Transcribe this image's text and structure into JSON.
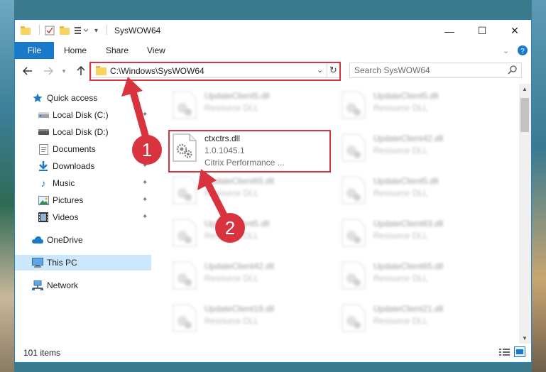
{
  "window": {
    "title": "SysWOW64",
    "minimize_glyph": "—",
    "maximize_glyph": "☐",
    "close_glyph": "✕"
  },
  "ribbon": {
    "file_tab": "File",
    "tabs": [
      "Home",
      "Share",
      "View"
    ]
  },
  "address_bar": {
    "path": "C:\\Windows\\SysWOW64"
  },
  "search": {
    "placeholder": "Search SysWOW64"
  },
  "nav_pane": {
    "items": [
      {
        "label": "Quick access",
        "icon": "star-icon"
      },
      {
        "label": "Local Disk (C:)",
        "icon": "drive-icon"
      },
      {
        "label": "Local Disk (D:)",
        "icon": "drive-icon"
      },
      {
        "label": "Documents",
        "icon": "documents-icon"
      },
      {
        "label": "Downloads",
        "icon": "download-icon"
      },
      {
        "label": "Music",
        "icon": "music-icon"
      },
      {
        "label": "Pictures",
        "icon": "pictures-icon"
      },
      {
        "label": "Videos",
        "icon": "videos-icon"
      },
      {
        "label": "OneDrive",
        "icon": "cloud-icon"
      },
      {
        "label": "This PC",
        "icon": "computer-icon"
      },
      {
        "label": "Network",
        "icon": "network-icon"
      }
    ]
  },
  "files": [
    {
      "name": "UpdateClient5.dll",
      "desc": "Resource DLL",
      "blurred": true
    },
    {
      "name": "UpdateClient5.dll",
      "desc": "Resource DLL",
      "blurred": true
    },
    {
      "name": "ctxctrs.dll",
      "version": "1.0.1045.1",
      "desc": "Citrix Performance ...",
      "blurred": false
    },
    {
      "name": "UpdateClient42.dll",
      "desc": "Resource DLL",
      "blurred": true
    },
    {
      "name": "UpdateClient65.dll",
      "desc": "Resource DLL",
      "blurred": true
    },
    {
      "name": "UpdateClient5.dll",
      "desc": "Resource DLL",
      "blurred": true
    },
    {
      "name": "UpdateClient5.dll",
      "desc": "Resource DLL",
      "blurred": true
    },
    {
      "name": "UpdateClient63.dll",
      "desc": "Resource DLL",
      "blurred": true
    },
    {
      "name": "UpdateClient42.dll",
      "desc": "Resource DLL",
      "blurred": true
    },
    {
      "name": "UpdateClient65.dll",
      "desc": "Resource DLL",
      "blurred": true
    },
    {
      "name": "UpdateClient19.dll",
      "desc": "Resource DLL",
      "blurred": true
    },
    {
      "name": "UpdateClient21.dll",
      "desc": "Resource DLL",
      "blurred": true
    }
  ],
  "status_bar": {
    "item_count": "101 items"
  },
  "annotations": {
    "step1": "1",
    "step2": "2",
    "color": "#d9333f"
  },
  "colors": {
    "accent": "#1979ca",
    "selection": "#cce8ff",
    "folder": "#f8d35e"
  }
}
